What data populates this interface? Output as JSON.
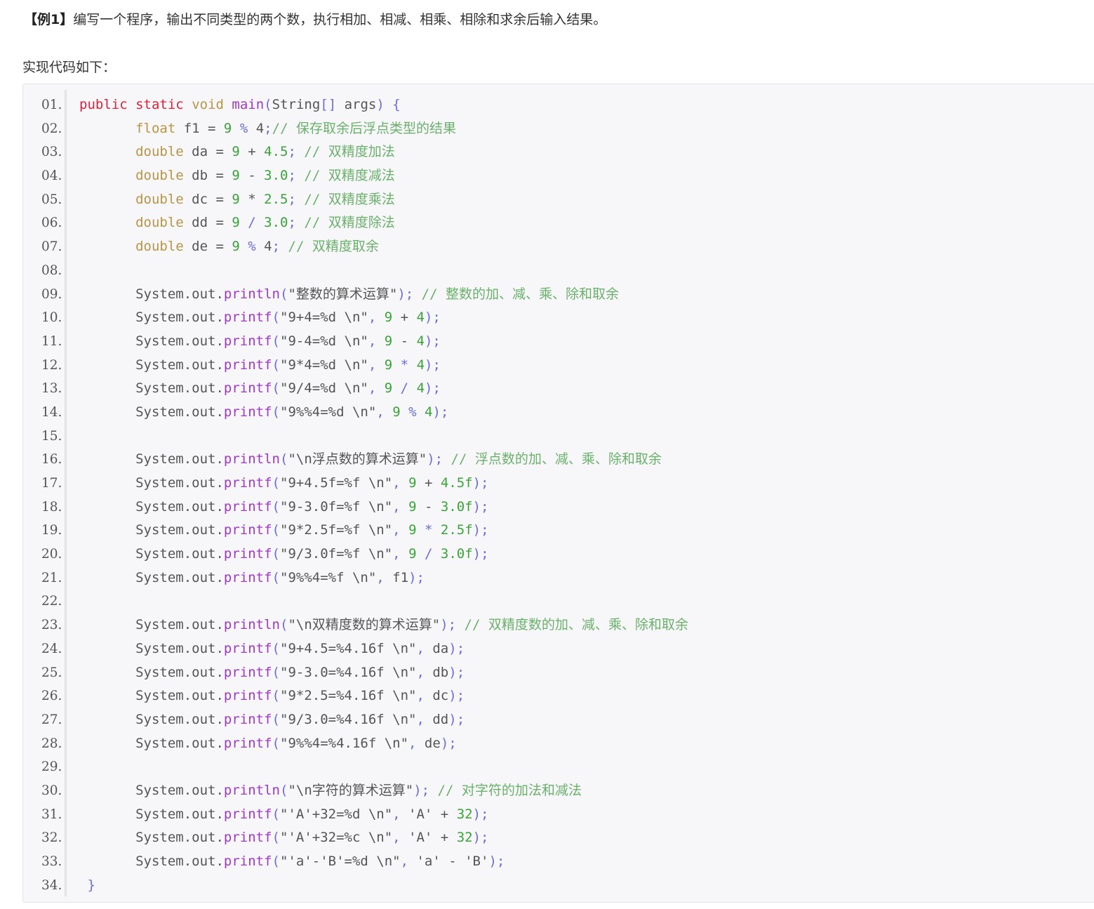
{
  "header": {
    "example_tag": "【例1】",
    "description": "编写一个程序，输出不同类型的两个数，执行相加、相减、相乘、相除和求余后输入结果。",
    "lead": "实现代码如下："
  },
  "colors": {
    "keyword": "#e0203a",
    "type": "#b89546",
    "function": "#a038c8",
    "number": "#3aa33a",
    "operator": "#6d6dd8",
    "comment": "#6bb06b",
    "text": "#555555"
  },
  "code": {
    "lines": [
      {
        "num": "01.",
        "tokens": [
          [
            "kw",
            "public"
          ],
          [
            "id",
            " "
          ],
          [
            "kw",
            "static"
          ],
          [
            "id",
            " "
          ],
          [
            "ty",
            "void"
          ],
          [
            "id",
            " "
          ],
          [
            "fn",
            "main"
          ],
          [
            "pn",
            "("
          ],
          [
            "id",
            "String"
          ],
          [
            "pn",
            "[]"
          ],
          [
            "id",
            " args"
          ],
          [
            "pn",
            ")"
          ],
          [
            "id",
            " "
          ],
          [
            "pn",
            "{"
          ]
        ]
      },
      {
        "num": "02.",
        "tokens": [
          [
            "id",
            "       "
          ],
          [
            "ty",
            "float"
          ],
          [
            "id",
            " f1 = "
          ],
          [
            "nm",
            "9"
          ],
          [
            "id",
            " "
          ],
          [
            "op",
            "%"
          ],
          [
            "id",
            " 4"
          ],
          [
            "pn",
            ";"
          ],
          [
            "cm",
            "// 保存取余后浮点类型的结果"
          ]
        ]
      },
      {
        "num": "03.",
        "tokens": [
          [
            "id",
            "       "
          ],
          [
            "ty",
            "double"
          ],
          [
            "id",
            " da = "
          ],
          [
            "nm",
            "9"
          ],
          [
            "id",
            " + "
          ],
          [
            "nm",
            "4.5"
          ],
          [
            "pn",
            ";"
          ],
          [
            "id",
            " "
          ],
          [
            "cm",
            "// 双精度加法"
          ]
        ]
      },
      {
        "num": "04.",
        "tokens": [
          [
            "id",
            "       "
          ],
          [
            "ty",
            "double"
          ],
          [
            "id",
            " db = "
          ],
          [
            "nm",
            "9"
          ],
          [
            "id",
            " - "
          ],
          [
            "nm",
            "3.0"
          ],
          [
            "pn",
            ";"
          ],
          [
            "id",
            " "
          ],
          [
            "cm",
            "// 双精度减法"
          ]
        ]
      },
      {
        "num": "05.",
        "tokens": [
          [
            "id",
            "       "
          ],
          [
            "ty",
            "double"
          ],
          [
            "id",
            " dc = "
          ],
          [
            "nm",
            "9"
          ],
          [
            "id",
            " * "
          ],
          [
            "nm",
            "2.5"
          ],
          [
            "pn",
            ";"
          ],
          [
            "id",
            " "
          ],
          [
            "cm",
            "// 双精度乘法"
          ]
        ]
      },
      {
        "num": "06.",
        "tokens": [
          [
            "id",
            "       "
          ],
          [
            "ty",
            "double"
          ],
          [
            "id",
            " dd = "
          ],
          [
            "nm",
            "9"
          ],
          [
            "id",
            " "
          ],
          [
            "op",
            "/"
          ],
          [
            "id",
            " "
          ],
          [
            "nm",
            "3.0"
          ],
          [
            "pn",
            ";"
          ],
          [
            "id",
            " "
          ],
          [
            "cm",
            "// 双精度除法"
          ]
        ]
      },
      {
        "num": "07.",
        "tokens": [
          [
            "id",
            "       "
          ],
          [
            "ty",
            "double"
          ],
          [
            "id",
            " de = "
          ],
          [
            "nm",
            "9"
          ],
          [
            "id",
            " "
          ],
          [
            "op",
            "%"
          ],
          [
            "id",
            " 4"
          ],
          [
            "pn",
            ";"
          ],
          [
            "id",
            " "
          ],
          [
            "cm",
            "// 双精度取余"
          ]
        ]
      },
      {
        "num": "08.",
        "tokens": []
      },
      {
        "num": "09.",
        "tokens": [
          [
            "id",
            "       System.out."
          ],
          [
            "fn",
            "println"
          ],
          [
            "pn",
            "("
          ],
          [
            "st",
            "\"整数的算术运算\""
          ],
          [
            "pn",
            ");"
          ],
          [
            "id",
            " "
          ],
          [
            "cm",
            "// 整数的加、减、乘、除和取余"
          ]
        ]
      },
      {
        "num": "10.",
        "tokens": [
          [
            "id",
            "       System.out."
          ],
          [
            "fn",
            "printf"
          ],
          [
            "pn",
            "("
          ],
          [
            "st",
            "\"9+4=%d \\n\""
          ],
          [
            "pn",
            ","
          ],
          [
            "id",
            " "
          ],
          [
            "nm",
            "9"
          ],
          [
            "id",
            " + "
          ],
          [
            "nm",
            "4"
          ],
          [
            "pn",
            ");"
          ]
        ]
      },
      {
        "num": "11.",
        "tokens": [
          [
            "id",
            "       System.out."
          ],
          [
            "fn",
            "printf"
          ],
          [
            "pn",
            "("
          ],
          [
            "st",
            "\"9-4=%d \\n\""
          ],
          [
            "pn",
            ","
          ],
          [
            "id",
            " "
          ],
          [
            "nm",
            "9"
          ],
          [
            "id",
            " - "
          ],
          [
            "nm",
            "4"
          ],
          [
            "pn",
            ");"
          ]
        ]
      },
      {
        "num": "12.",
        "tokens": [
          [
            "id",
            "       System.out."
          ],
          [
            "fn",
            "printf"
          ],
          [
            "pn",
            "("
          ],
          [
            "st",
            "\"9*4=%d \\n\""
          ],
          [
            "pn",
            ","
          ],
          [
            "id",
            " "
          ],
          [
            "nm",
            "9"
          ],
          [
            "id",
            " "
          ],
          [
            "op",
            "*"
          ],
          [
            "id",
            " "
          ],
          [
            "nm",
            "4"
          ],
          [
            "pn",
            ");"
          ]
        ]
      },
      {
        "num": "13.",
        "tokens": [
          [
            "id",
            "       System.out."
          ],
          [
            "fn",
            "printf"
          ],
          [
            "pn",
            "("
          ],
          [
            "st",
            "\"9/4=%d \\n\""
          ],
          [
            "pn",
            ","
          ],
          [
            "id",
            " "
          ],
          [
            "nm",
            "9"
          ],
          [
            "id",
            " "
          ],
          [
            "op",
            "/"
          ],
          [
            "id",
            " "
          ],
          [
            "nm",
            "4"
          ],
          [
            "pn",
            ");"
          ]
        ]
      },
      {
        "num": "14.",
        "tokens": [
          [
            "id",
            "       System.out."
          ],
          [
            "fn",
            "printf"
          ],
          [
            "pn",
            "("
          ],
          [
            "st",
            "\"9%%4=%d \\n\""
          ],
          [
            "pn",
            ","
          ],
          [
            "id",
            " "
          ],
          [
            "nm",
            "9"
          ],
          [
            "id",
            " "
          ],
          [
            "op",
            "%"
          ],
          [
            "id",
            " "
          ],
          [
            "nm",
            "4"
          ],
          [
            "pn",
            ");"
          ]
        ]
      },
      {
        "num": "15.",
        "tokens": []
      },
      {
        "num": "16.",
        "tokens": [
          [
            "id",
            "       System.out."
          ],
          [
            "fn",
            "println"
          ],
          [
            "pn",
            "("
          ],
          [
            "st",
            "\"\\n浮点数的算术运算\""
          ],
          [
            "pn",
            ");"
          ],
          [
            "id",
            " "
          ],
          [
            "cm",
            "// 浮点数的加、减、乘、除和取余"
          ]
        ]
      },
      {
        "num": "17.",
        "tokens": [
          [
            "id",
            "       System.out."
          ],
          [
            "fn",
            "printf"
          ],
          [
            "pn",
            "("
          ],
          [
            "st",
            "\"9+4.5f=%f \\n\""
          ],
          [
            "pn",
            ","
          ],
          [
            "id",
            " "
          ],
          [
            "nm",
            "9"
          ],
          [
            "id",
            " + "
          ],
          [
            "nm",
            "4.5f"
          ],
          [
            "pn",
            ");"
          ]
        ]
      },
      {
        "num": "18.",
        "tokens": [
          [
            "id",
            "       System.out."
          ],
          [
            "fn",
            "printf"
          ],
          [
            "pn",
            "("
          ],
          [
            "st",
            "\"9-3.0f=%f \\n\""
          ],
          [
            "pn",
            ","
          ],
          [
            "id",
            " "
          ],
          [
            "nm",
            "9"
          ],
          [
            "id",
            " - "
          ],
          [
            "nm",
            "3.0f"
          ],
          [
            "pn",
            ");"
          ]
        ]
      },
      {
        "num": "19.",
        "tokens": [
          [
            "id",
            "       System.out."
          ],
          [
            "fn",
            "printf"
          ],
          [
            "pn",
            "("
          ],
          [
            "st",
            "\"9*2.5f=%f \\n\""
          ],
          [
            "pn",
            ","
          ],
          [
            "id",
            " "
          ],
          [
            "nm",
            "9"
          ],
          [
            "id",
            " "
          ],
          [
            "op",
            "*"
          ],
          [
            "id",
            " "
          ],
          [
            "nm",
            "2.5f"
          ],
          [
            "pn",
            ");"
          ]
        ]
      },
      {
        "num": "20.",
        "tokens": [
          [
            "id",
            "       System.out."
          ],
          [
            "fn",
            "printf"
          ],
          [
            "pn",
            "("
          ],
          [
            "st",
            "\"9/3.0f=%f \\n\""
          ],
          [
            "pn",
            ","
          ],
          [
            "id",
            " "
          ],
          [
            "nm",
            "9"
          ],
          [
            "id",
            " "
          ],
          [
            "op",
            "/"
          ],
          [
            "id",
            " "
          ],
          [
            "nm",
            "3.0f"
          ],
          [
            "pn",
            ");"
          ]
        ]
      },
      {
        "num": "21.",
        "tokens": [
          [
            "id",
            "       System.out."
          ],
          [
            "fn",
            "printf"
          ],
          [
            "pn",
            "("
          ],
          [
            "st",
            "\"9%%4=%f \\n\""
          ],
          [
            "pn",
            ","
          ],
          [
            "id",
            " f1"
          ],
          [
            "pn",
            ");"
          ]
        ]
      },
      {
        "num": "22.",
        "tokens": []
      },
      {
        "num": "23.",
        "tokens": [
          [
            "id",
            "       System.out."
          ],
          [
            "fn",
            "println"
          ],
          [
            "pn",
            "("
          ],
          [
            "st",
            "\"\\n双精度数的算术运算\""
          ],
          [
            "pn",
            ");"
          ],
          [
            "id",
            " "
          ],
          [
            "cm",
            "// 双精度数的加、减、乘、除和取余"
          ]
        ]
      },
      {
        "num": "24.",
        "tokens": [
          [
            "id",
            "       System.out."
          ],
          [
            "fn",
            "printf"
          ],
          [
            "pn",
            "("
          ],
          [
            "st",
            "\"9+4.5=%4.16f \\n\""
          ],
          [
            "pn",
            ","
          ],
          [
            "id",
            " da"
          ],
          [
            "pn",
            ");"
          ]
        ]
      },
      {
        "num": "25.",
        "tokens": [
          [
            "id",
            "       System.out."
          ],
          [
            "fn",
            "printf"
          ],
          [
            "pn",
            "("
          ],
          [
            "st",
            "\"9-3.0=%4.16f \\n\""
          ],
          [
            "pn",
            ","
          ],
          [
            "id",
            " db"
          ],
          [
            "pn",
            ");"
          ]
        ]
      },
      {
        "num": "26.",
        "tokens": [
          [
            "id",
            "       System.out."
          ],
          [
            "fn",
            "printf"
          ],
          [
            "pn",
            "("
          ],
          [
            "st",
            "\"9*2.5=%4.16f \\n\""
          ],
          [
            "pn",
            ","
          ],
          [
            "id",
            " dc"
          ],
          [
            "pn",
            ");"
          ]
        ]
      },
      {
        "num": "27.",
        "tokens": [
          [
            "id",
            "       System.out."
          ],
          [
            "fn",
            "printf"
          ],
          [
            "pn",
            "("
          ],
          [
            "st",
            "\"9/3.0=%4.16f \\n\""
          ],
          [
            "pn",
            ","
          ],
          [
            "id",
            " dd"
          ],
          [
            "pn",
            ");"
          ]
        ]
      },
      {
        "num": "28.",
        "tokens": [
          [
            "id",
            "       System.out."
          ],
          [
            "fn",
            "printf"
          ],
          [
            "pn",
            "("
          ],
          [
            "st",
            "\"9%%4=%4.16f \\n\""
          ],
          [
            "pn",
            ","
          ],
          [
            "id",
            " de"
          ],
          [
            "pn",
            ");"
          ]
        ]
      },
      {
        "num": "29.",
        "tokens": []
      },
      {
        "num": "30.",
        "tokens": [
          [
            "id",
            "       System.out."
          ],
          [
            "fn",
            "println"
          ],
          [
            "pn",
            "("
          ],
          [
            "st",
            "\"\\n字符的算术运算\""
          ],
          [
            "pn",
            ");"
          ],
          [
            "id",
            " "
          ],
          [
            "cm",
            "// 对字符的加法和减法"
          ]
        ]
      },
      {
        "num": "31.",
        "tokens": [
          [
            "id",
            "       System.out."
          ],
          [
            "fn",
            "printf"
          ],
          [
            "pn",
            "("
          ],
          [
            "st",
            "\"'A'+32=%d \\n\""
          ],
          [
            "pn",
            ","
          ],
          [
            "id",
            " 'A' + "
          ],
          [
            "nm",
            "32"
          ],
          [
            "pn",
            ");"
          ]
        ]
      },
      {
        "num": "32.",
        "tokens": [
          [
            "id",
            "       System.out."
          ],
          [
            "fn",
            "printf"
          ],
          [
            "pn",
            "("
          ],
          [
            "st",
            "\"'A'+32=%c \\n\""
          ],
          [
            "pn",
            ","
          ],
          [
            "id",
            " 'A' + "
          ],
          [
            "nm",
            "32"
          ],
          [
            "pn",
            ");"
          ]
        ]
      },
      {
        "num": "33.",
        "tokens": [
          [
            "id",
            "       System.out."
          ],
          [
            "fn",
            "printf"
          ],
          [
            "pn",
            "("
          ],
          [
            "st",
            "\"'a'-'B'=%d \\n\""
          ],
          [
            "pn",
            ","
          ],
          [
            "id",
            " 'a' - 'B'"
          ],
          [
            "pn",
            ");"
          ]
        ]
      },
      {
        "num": "34.",
        "tokens": [
          [
            "id",
            " "
          ],
          [
            "pn",
            "}"
          ]
        ]
      }
    ]
  }
}
